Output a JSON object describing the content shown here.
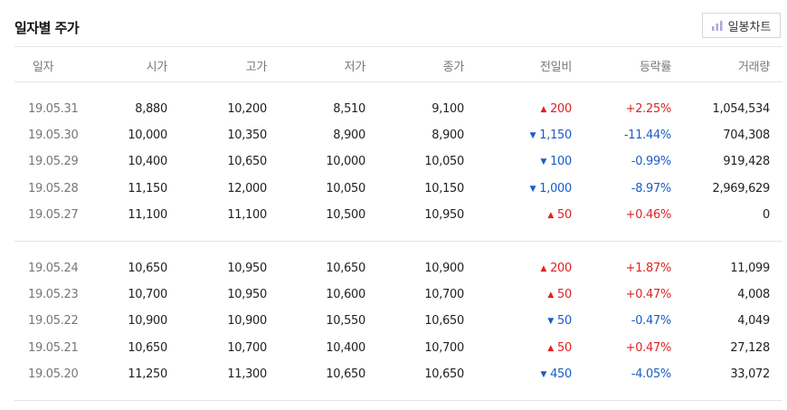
{
  "title": "일자별 주가",
  "chart_button": {
    "label": "일봉차트",
    "icon": "bar-chart-icon"
  },
  "colors": {
    "up": "#e02222",
    "down": "#1a5cc8"
  },
  "columns": [
    "일자",
    "시가",
    "고가",
    "저가",
    "종가",
    "전일비",
    "등락률",
    "거래량"
  ],
  "groups": [
    [
      {
        "date": "19.05.31",
        "open": "8,880",
        "high": "10,200",
        "low": "8,510",
        "close": "9,100",
        "dir": "up",
        "change": "200",
        "rate": "+2.25%",
        "volume": "1,054,534"
      },
      {
        "date": "19.05.30",
        "open": "10,000",
        "high": "10,350",
        "low": "8,900",
        "close": "8,900",
        "dir": "down",
        "change": "1,150",
        "rate": "-11.44%",
        "volume": "704,308"
      },
      {
        "date": "19.05.29",
        "open": "10,400",
        "high": "10,650",
        "low": "10,000",
        "close": "10,050",
        "dir": "down",
        "change": "100",
        "rate": "-0.99%",
        "volume": "919,428"
      },
      {
        "date": "19.05.28",
        "open": "11,150",
        "high": "12,000",
        "low": "10,050",
        "close": "10,150",
        "dir": "down",
        "change": "1,000",
        "rate": "-8.97%",
        "volume": "2,969,629"
      },
      {
        "date": "19.05.27",
        "open": "11,100",
        "high": "11,100",
        "low": "10,500",
        "close": "10,950",
        "dir": "up",
        "change": "50",
        "rate": "+0.46%",
        "volume": "0"
      }
    ],
    [
      {
        "date": "19.05.24",
        "open": "10,650",
        "high": "10,950",
        "low": "10,650",
        "close": "10,900",
        "dir": "up",
        "change": "200",
        "rate": "+1.87%",
        "volume": "11,099"
      },
      {
        "date": "19.05.23",
        "open": "10,700",
        "high": "10,950",
        "low": "10,600",
        "close": "10,700",
        "dir": "up",
        "change": "50",
        "rate": "+0.47%",
        "volume": "4,008"
      },
      {
        "date": "19.05.22",
        "open": "10,900",
        "high": "10,900",
        "low": "10,550",
        "close": "10,650",
        "dir": "down",
        "change": "50",
        "rate": "-0.47%",
        "volume": "4,049"
      },
      {
        "date": "19.05.21",
        "open": "10,650",
        "high": "10,700",
        "low": "10,400",
        "close": "10,700",
        "dir": "up",
        "change": "50",
        "rate": "+0.47%",
        "volume": "27,128"
      },
      {
        "date": "19.05.20",
        "open": "11,250",
        "high": "11,300",
        "low": "10,650",
        "close": "10,650",
        "dir": "down",
        "change": "450",
        "rate": "-4.05%",
        "volume": "33,072"
      }
    ]
  ]
}
